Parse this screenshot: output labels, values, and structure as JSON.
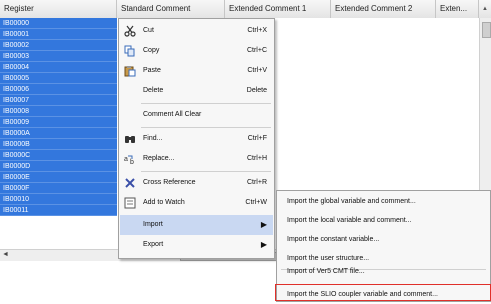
{
  "header": {
    "columns": [
      "Register",
      "Standard Comment",
      "Extended Comment 1",
      "Extended Comment 2",
      "Exten..."
    ],
    "scroll_arrow": "▲"
  },
  "registers": [
    "IB00000",
    "IB00001",
    "IB00002",
    "IB00003",
    "IB00004",
    "IB00005",
    "IB00006",
    "IB00007",
    "IB00008",
    "IB00009",
    "IB0000A",
    "IB0000B",
    "IB0000C",
    "IB0000D",
    "IB0000E",
    "IB0000F",
    "IB00010",
    "IB00011"
  ],
  "scroll": {
    "left_arrow": "◄",
    "thumb_grip": "|||"
  },
  "menu": {
    "cut": {
      "label": "Cut",
      "shortcut": "Ctrl+X",
      "icon": "scissors-icon"
    },
    "copy": {
      "label": "Copy",
      "shortcut": "Ctrl+C",
      "icon": "copy-icon"
    },
    "paste": {
      "label": "Paste",
      "shortcut": "Ctrl+V",
      "icon": "paste-icon"
    },
    "delete": {
      "label": "Delete",
      "shortcut": "Delete"
    },
    "comment_all_clear": {
      "label": "Comment All Clear"
    },
    "find": {
      "label": "Find...",
      "shortcut": "Ctrl+F",
      "icon": "binoculars-icon"
    },
    "replace": {
      "label": "Replace...",
      "shortcut": "Ctrl+H",
      "icon": "replace-icon"
    },
    "cross_reference": {
      "label": "Cross Reference",
      "shortcut": "Ctrl+R",
      "icon": "cross-reference-icon"
    },
    "add_to_watch": {
      "label": "Add to Watch",
      "shortcut": "Ctrl+W",
      "icon": "watch-icon"
    },
    "import": {
      "label": "Import",
      "arrow": "▶"
    },
    "export": {
      "label": "Export",
      "arrow": "▶"
    }
  },
  "submenu": [
    "Import the global variable and comment...",
    "Import the local variable and comment...",
    "Import the constant variable...",
    "Import the user structure...",
    "Import of Ver5 CMT file...",
    "Import the SLIO coupler variable and comment..."
  ],
  "colors": {
    "selection": "#3377dd",
    "highlight": "#c9d8f2",
    "callout": "#e0302a"
  }
}
